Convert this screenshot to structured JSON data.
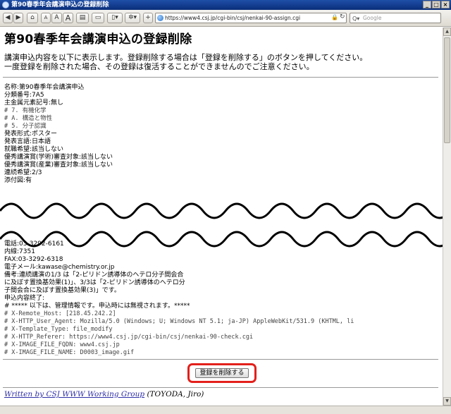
{
  "window": {
    "title": "第90春季年会講演申込の登録削除"
  },
  "toolbar": {
    "url": "https://www4.csj.jp/cgi-bin/csj/nenkai-90-assign.cgi",
    "search_placeholder": "Google",
    "font_small": "A",
    "font_medium": "A",
    "font_large": "A"
  },
  "page": {
    "title": "第90春季年会講演申込の登録削除",
    "intro_line1": "講演申込内容を以下に表示します。登録削除する場合は「登録を削除する」のボタンを押してください。",
    "intro_line2": "一度登録を削除された場合、その登録は復活することができませんのでご注意ください。"
  },
  "record_top": [
    "名称:第90春季年会講演申込",
    "分類番号:7A5",
    "主金属元素記号:無し",
    "# 7. 有機化学",
    "#      A. 構造と物性",
    "#           5. 分子認識",
    "発表形式:ポスター",
    "発表言語:日本語",
    "就職希望:該当しない",
    "優秀講演賞(学術)審査対象:該当しない",
    "優秀講演賞(産業)審査対象:該当しない",
    "連続希望:2/3",
    "添付図:有"
  ],
  "record_bottom": [
    "電話:03-3292-6161",
    "内線:7351",
    "FAX:03-3292-6318",
    "電子メール:kawase@chemistry.or.jp",
    "備考:連続講演の1/3 は「2-ピリドン誘導体のヘテロ分子間会合",
    "に及ぼす置換基効果(1)」、3/3は「2-ピリドン誘導体のヘテロ分",
    "子間会合に及ぼす置換基効果(3)」です。",
    "申込内容終了:",
    "# ***** 以下は、管理情報です。申込時には無視されます。*****",
    "# X-Remote_Host:  [218.45.242.2]",
    "# X-HTTP_User_Agent: Mozilla/5.0 (Windows; U; Windows NT 5.1; ja-JP) AppleWebKit/531.9 (KHTML, li",
    "# X-Template_Type: file_modify",
    "# X-HTTP_Referer: https://www4.csj.jp/cgi-bin/csj/nenkai-90-check.cgi",
    "# X-IMAGE_FILE_FQDN: www4.csj.jp",
    "# X-IMAGE_FILE_NAME: D0003_image.gif"
  ],
  "actions": {
    "delete_label": "登録を削除する"
  },
  "footer": {
    "link_text": "Written by CSJ WWW Working Group",
    "author": " (TOYODA, Jiro)"
  }
}
